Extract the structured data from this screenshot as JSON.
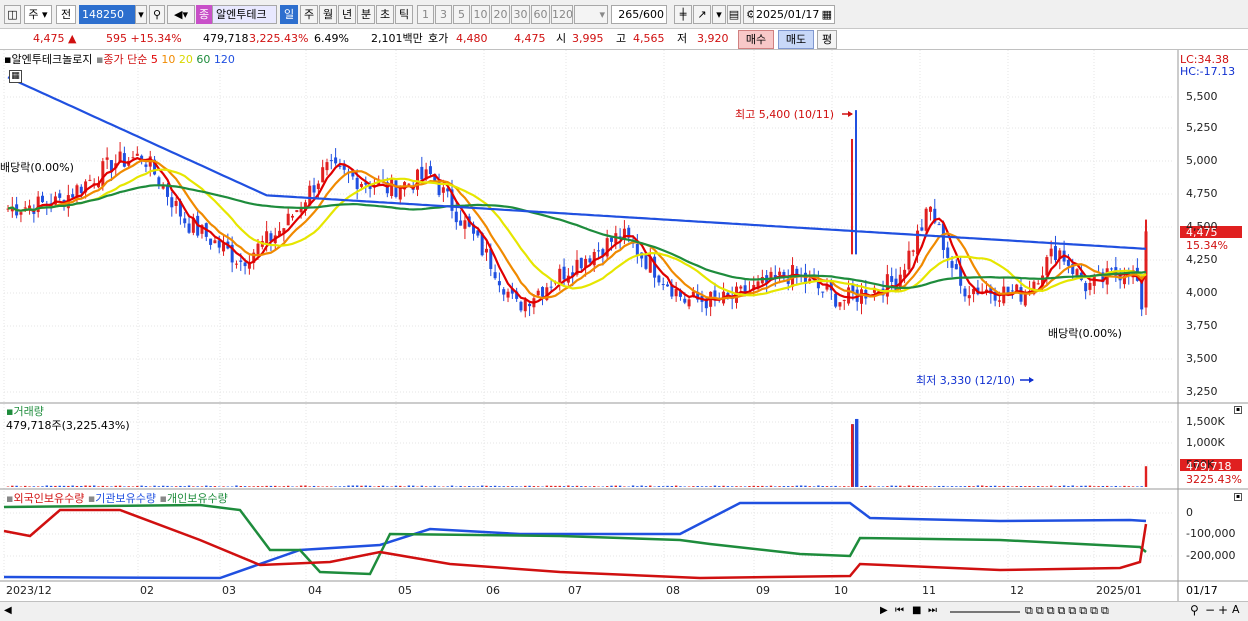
{
  "toolbar": {
    "period_type": "주",
    "adj_type": "전",
    "code": "148250",
    "badge": "종",
    "stock_name": "알엔투테크",
    "tabs": [
      "일",
      "주",
      "월",
      "년",
      "분",
      "초",
      "틱"
    ],
    "active_tab": "일",
    "nums": [
      "1",
      "3",
      "5",
      "10",
      "20",
      "30",
      "60",
      "120"
    ],
    "count": "265",
    "count_total": "/600",
    "date": "2025/01/17"
  },
  "info": {
    "price": "4,475",
    "change": "595 +15.34%",
    "volume": "479,718",
    "volume_pct": "3,225.43%",
    "turnover": "6.49%",
    "amount": "2,101백만",
    "bid_label": "호가",
    "bid": "4,480",
    "ask": "4,475",
    "open_label": "시",
    "open": "3,995",
    "high_label": "고",
    "high": "4,565",
    "low_label": "저",
    "low": "3,920",
    "buy_label": "매수",
    "sell_label": "매도",
    "eval_label": "평"
  },
  "price_panel": {
    "legend_name": "알엔투테크놀로지",
    "legend_title": "종가 단순",
    "ma": [
      {
        "period": "5",
        "color": "#e00000"
      },
      {
        "period": "10",
        "color": "#f08a00"
      },
      {
        "period": "20",
        "color": "#e6e600"
      },
      {
        "period": "60",
        "color": "#1e8c3c"
      },
      {
        "period": "120",
        "color": "#2050e0"
      }
    ],
    "lc": "LC:34.38",
    "hc": "HC:-17.13",
    "y_ticks": [
      "5,500",
      "5,250",
      "5,000",
      "4,750",
      "4,500",
      "4,250",
      "4,000",
      "3,750",
      "3,500",
      "3,250"
    ],
    "high_annotation": "최고 5,400 (10/11)",
    "low_annotation": "최저 3,330 (12/10)",
    "div_left": "배당락(0.00%)",
    "div_right": "배당락(0.00%)",
    "last_price": "4,475",
    "last_pct": "15.34%"
  },
  "volume_panel": {
    "title": "거래량",
    "sub": "479,718주(3,225.43%)",
    "y_ticks": [
      "1,500K",
      "1,000K",
      "500K"
    ],
    "last_value": "479,718",
    "last_pct": "3225.43%"
  },
  "holding_panel": {
    "series": [
      {
        "name": "외국인보유수량",
        "color": "#d01010"
      },
      {
        "name": "기관보유수량",
        "color": "#2050e0"
      },
      {
        "name": "개인보유수량",
        "color": "#1e8c3c"
      }
    ],
    "y_ticks": [
      "0",
      "-100,000",
      "-200,000"
    ]
  },
  "x_axis": {
    "labels": [
      "2023/12",
      "02",
      "03",
      "04",
      "05",
      "06",
      "07",
      "08",
      "09",
      "10",
      "11",
      "12",
      "2025/01"
    ],
    "right_label": "01/17"
  }
}
